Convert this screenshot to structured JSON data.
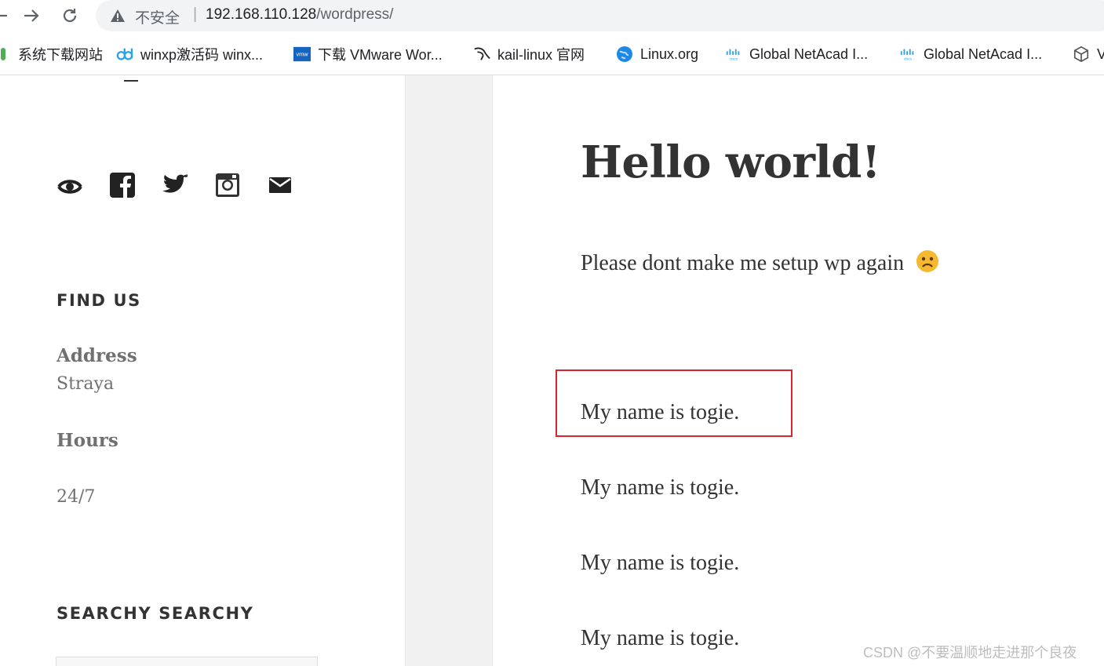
{
  "browser": {
    "insecure_label": "不安全",
    "separator": "|",
    "url_host": "192.168.110.128",
    "url_path": "/wordpress/",
    "bookmarks": [
      {
        "label": "系统下载网站",
        "icon": "green-bookmark-icon"
      },
      {
        "label": "winxp激活码 winx...",
        "icon": "dd-logo-icon"
      },
      {
        "label": "下载 VMware Wor...",
        "icon": "vmw-logo-icon"
      },
      {
        "label": "kail-linux 官网",
        "icon": "kali-dragon-icon"
      },
      {
        "label": "Linux.org",
        "icon": "globe-icon"
      },
      {
        "label": "Global NetAcad I...",
        "icon": "cisco-icon"
      },
      {
        "label": "Global NetAcad I...",
        "icon": "cisco-icon"
      },
      {
        "label": "V",
        "icon": "cube-icon"
      }
    ]
  },
  "sidebar": {
    "social_icons": [
      "wordpress-icon",
      "facebook-icon",
      "twitter-icon",
      "instagram-icon",
      "email-icon"
    ],
    "find_us_title": "FIND US",
    "address_label": "Address",
    "address_value": "Straya",
    "hours_label": "Hours",
    "hours_value": "24/7",
    "search_title": "SEARCHY SEARCHY"
  },
  "post": {
    "title": "Hello world!",
    "intro": "Please dont make me setup wp again",
    "intro_emoji": "sad-face-emoji",
    "lines": [
      "My name is togie.",
      "My name is togie.",
      "My name is togie.",
      "My name is togie."
    ]
  },
  "watermark": "CSDN @不要温顺地走进那个良夜",
  "colors": {
    "highlight": "#d9232e",
    "gutter": "#f1f1f1",
    "text": "#333333",
    "muted": "#707070"
  }
}
